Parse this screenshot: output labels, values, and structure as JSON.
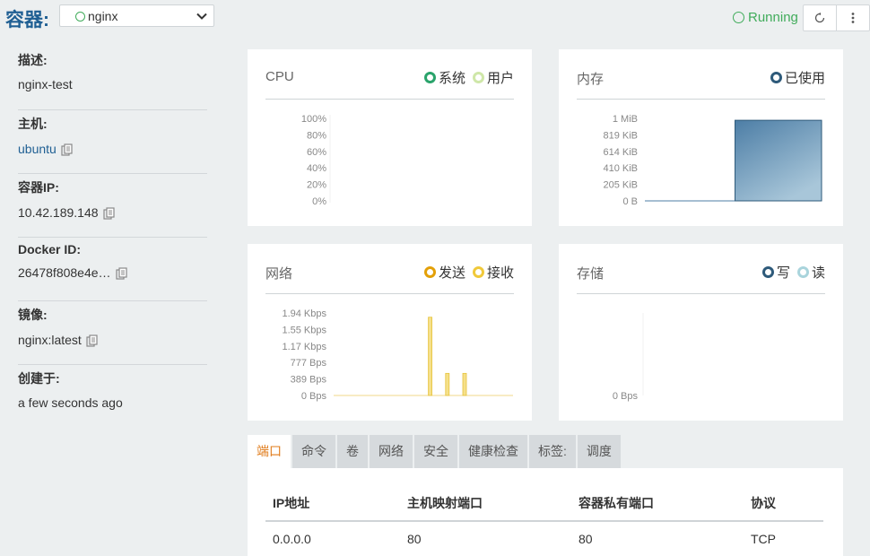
{
  "header": {
    "title": "容器:",
    "selected_container": "nginx",
    "status": "Running"
  },
  "colors": {
    "accent": "#1f5f93",
    "running": "#41ac5b",
    "sys_series": "#2aa36b",
    "user_series": "#cfe7a9",
    "mem_series": "#2e5a7a",
    "send_series": "#e3a008",
    "recv_series": "#f0c93a",
    "write_series": "#2e5a7a",
    "read_series": "#a9d4dc",
    "active_tab": "#e07b1a"
  },
  "icons": {
    "refresh": "refresh-icon",
    "more": "more-vertical-icon",
    "copy": "copy-icon",
    "chevron": "chevron-down-icon"
  },
  "sidebar": {
    "fields": [
      {
        "label": "描述:",
        "value": "nginx-test"
      },
      {
        "label": "主机:",
        "value": "ubuntu"
      },
      {
        "label": "容器IP:",
        "value": "10.42.189.148"
      },
      {
        "label": "Docker ID:",
        "value": "26478f808e4e…"
      },
      {
        "label": "镜像:",
        "value": "nginx:latest"
      },
      {
        "label": "创建于:",
        "value": "a few seconds ago"
      }
    ]
  },
  "cards": {
    "cpu": {
      "title": "CPU",
      "legend": [
        "系统",
        "用户"
      ]
    },
    "memory": {
      "title": "内存",
      "legend": [
        "已使用"
      ]
    },
    "network": {
      "title": "网络",
      "legend": [
        "发送",
        "接收"
      ]
    },
    "storage": {
      "title": "存储",
      "legend": [
        "写",
        "读"
      ]
    }
  },
  "chart_data": [
    {
      "type": "line",
      "title": "CPU",
      "y_ticks": [
        "100%",
        "80%",
        "60%",
        "40%",
        "20%",
        "0%"
      ],
      "ylim": [
        0,
        100
      ],
      "series": [
        {
          "name": "系统",
          "values": []
        },
        {
          "name": "用户",
          "values": []
        }
      ]
    },
    {
      "type": "area",
      "title": "内存",
      "y_ticks": [
        "1 MiB",
        "819 KiB",
        "614 KiB",
        "410 KiB",
        "205 KiB",
        "0 B"
      ],
      "ylim": [
        0,
        1024
      ],
      "x": [
        0,
        1,
        2
      ],
      "series": [
        {
          "name": "已使用",
          "values": [
            0,
            0,
            1000
          ]
        }
      ]
    },
    {
      "type": "bar",
      "title": "网络",
      "y_ticks": [
        "1.94 Kbps",
        "1.55 Kbps",
        "1.17 Kbps",
        "777 Bps",
        "389 Bps",
        "0 Bps"
      ],
      "ylim": [
        0,
        1940
      ],
      "x": [
        0,
        22,
        23,
        26,
        30
      ],
      "series": [
        {
          "name": "接收",
          "values": [
            0,
            1840,
            0,
            520,
            520
          ]
        },
        {
          "name": "发送",
          "values": []
        }
      ]
    },
    {
      "type": "line",
      "title": "存储",
      "y_ticks": [
        "0 Bps"
      ],
      "series": [
        {
          "name": "写",
          "values": []
        },
        {
          "name": "读",
          "values": []
        }
      ]
    }
  ],
  "tabs": [
    "端口",
    "命令",
    "卷",
    "网络",
    "安全",
    "健康检查",
    "标签:",
    "调度"
  ],
  "ports_table": {
    "headers": [
      "IP地址",
      "主机映射端口",
      "容器私有端口",
      "协议"
    ],
    "rows": [
      [
        "0.0.0.0",
        "80",
        "80",
        "TCP"
      ]
    ]
  }
}
